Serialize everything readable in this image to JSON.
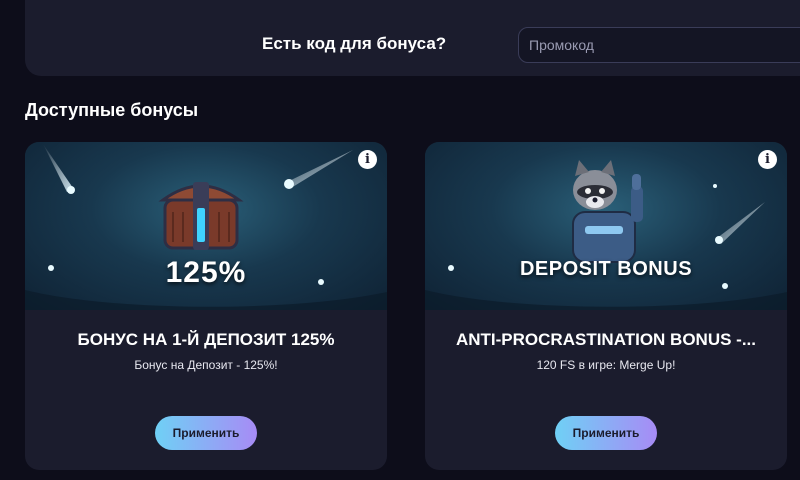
{
  "promo": {
    "question": "Есть код для бонуса?",
    "input_placeholder": "Промокод",
    "input_value": ""
  },
  "section": {
    "title": "Доступные бонусы"
  },
  "cards": [
    {
      "banner_text": "125%",
      "title": "БОНУС НА 1-Й ДЕПОЗИТ 125%",
      "subtitle": "Бонус на Депозит - 125%!",
      "apply_label": "Применить",
      "info_label": "i"
    },
    {
      "banner_text": "DEPOSIT BONUS",
      "title": "ANTI-PROCRASTINATION BONUS -...",
      "subtitle": "120 FS в игре: Merge Up!",
      "apply_label": "Применить",
      "info_label": "i"
    }
  ],
  "icons": {
    "info": "info-icon",
    "chest": "treasure-chest-icon",
    "raccoon": "raccoon-astronaut-icon",
    "comet": "comet-icon"
  },
  "colors": {
    "page_bg": "#0d0d1a",
    "panel_bg": "#1b1c2d",
    "button_gradient_start": "#6fd0f5",
    "button_gradient_end": "#a78bf5"
  }
}
